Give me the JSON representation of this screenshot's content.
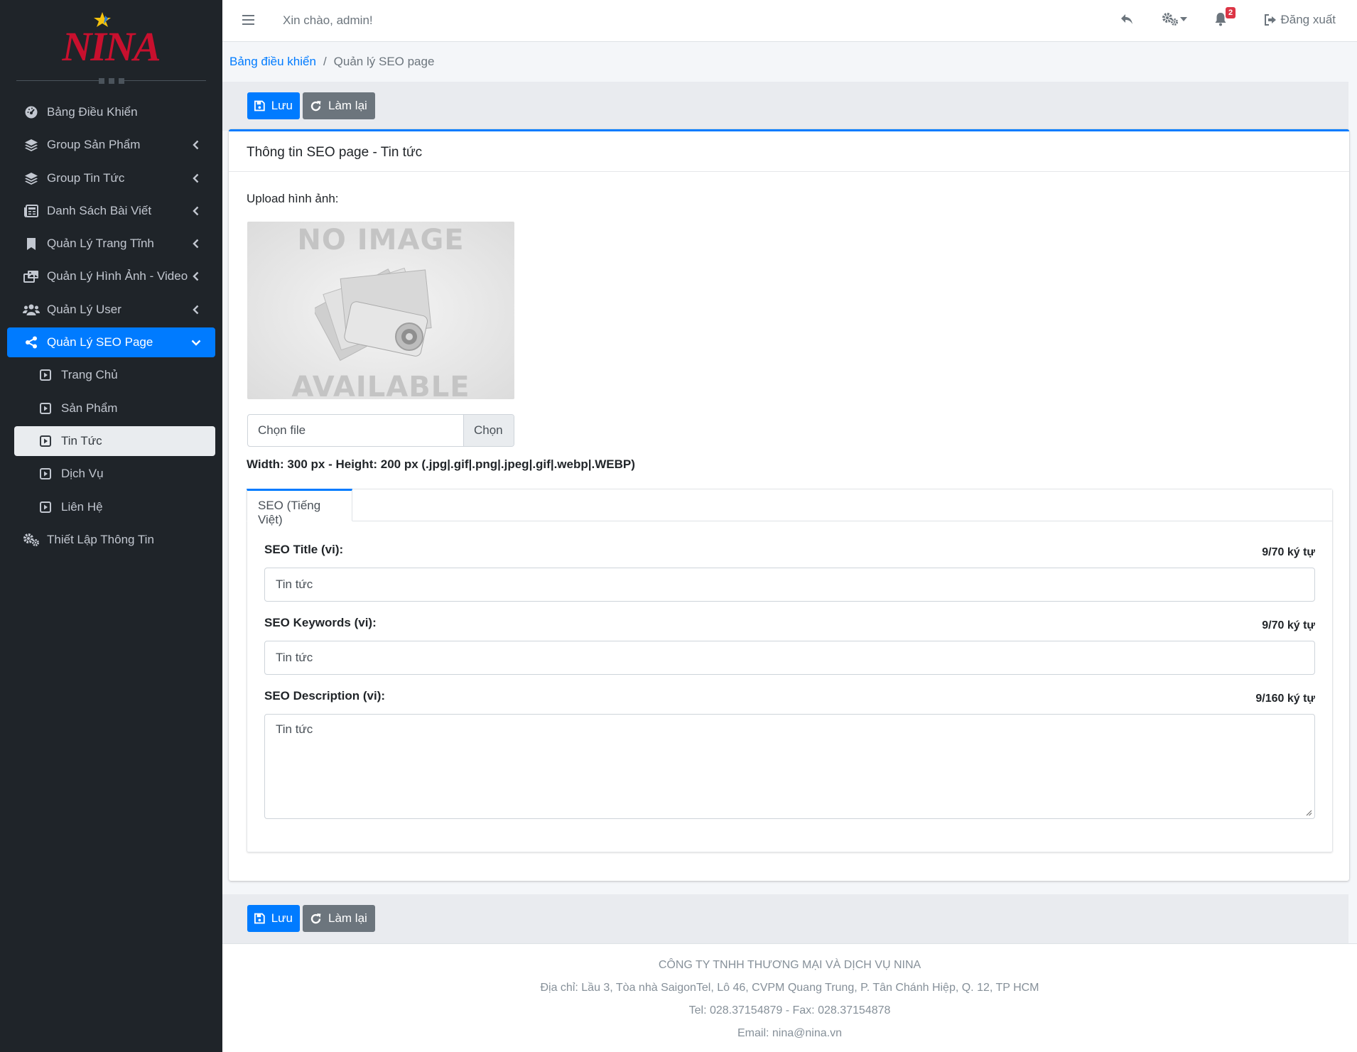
{
  "sidebar": {
    "logo_text": "NINA",
    "items": [
      {
        "label": "Bảng Điều Khiển",
        "icon": "dashboard-icon",
        "has_chevron": false
      },
      {
        "label": "Group Sản Phẩm",
        "icon": "layers-icon",
        "has_chevron": true
      },
      {
        "label": "Group Tin Tức",
        "icon": "layers-icon",
        "has_chevron": true
      },
      {
        "label": "Danh Sách Bài Viết",
        "icon": "newspaper-icon",
        "has_chevron": true
      },
      {
        "label": "Quản Lý Trang Tĩnh",
        "icon": "bookmark-icon",
        "has_chevron": true
      },
      {
        "label": "Quản Lý Hình Ảnh - Video",
        "icon": "photo-video-icon",
        "has_chevron": true
      },
      {
        "label": "Quản Lý User",
        "icon": "users-icon",
        "has_chevron": true
      },
      {
        "label": "Quản Lý SEO Page",
        "icon": "share-icon",
        "has_chevron": true,
        "active": true
      }
    ],
    "sub_items": [
      {
        "label": "Trang Chủ"
      },
      {
        "label": "Sản Phẩm"
      },
      {
        "label": "Tin Tức",
        "current": true
      },
      {
        "label": "Dịch Vụ"
      },
      {
        "label": "Liên Hệ"
      }
    ],
    "settings_item": {
      "label": "Thiết Lập Thông Tin",
      "icon": "cogs-icon"
    }
  },
  "topbar": {
    "greeting": "Xin chào, admin!",
    "notification_count": "2",
    "logout_label": "Đăng xuất"
  },
  "breadcrumb": {
    "home": "Bảng điều khiển",
    "current": "Quản lý SEO page"
  },
  "actions": {
    "save_label": "Lưu",
    "reset_label": "Làm lại"
  },
  "card": {
    "title": "Thông tin SEO page - Tin tức",
    "upload_label": "Upload hình ảnh:",
    "noimage_top": "NO IMAGE",
    "noimage_bottom": "AVAILABLE",
    "file_placeholder": "Chọn file",
    "file_button": "Chọn",
    "size_note": "Width: 300 px - Height: 200 px (.jpg|.gif|.png|.jpeg|.gif|.webp|.WEBP)"
  },
  "seo": {
    "tab_label": "SEO (Tiếng Việt)",
    "title_label": "SEO Title (vi):",
    "title_count": "9/70 ký tự",
    "title_value": "Tin tức",
    "keywords_label": "SEO Keywords (vi):",
    "keywords_count": "9/70 ký tự",
    "keywords_value": "Tin tức",
    "description_label": "SEO Description (vi):",
    "description_count": "9/160 ký tự",
    "description_value": "Tin tức"
  },
  "footer": {
    "company": "CÔNG TY TNHH THƯƠNG MẠI VÀ DỊCH VỤ NINA",
    "address": "Địa chỉ: Lầu 3, Tòa nhà SaigonTel, Lô 46, CVPM Quang Trung, P. Tân Chánh Hiệp, Q. 12, TP HCM",
    "phone": "Tel: 028.37154879 - Fax: 028.37154878",
    "email": "Email: nina@nina.vn"
  },
  "colors": {
    "sidebar_bg": "#1f2429",
    "primary": "#007bff",
    "secondary": "#6c757d",
    "danger": "#dc3545",
    "logo_red": "#c8102e"
  }
}
